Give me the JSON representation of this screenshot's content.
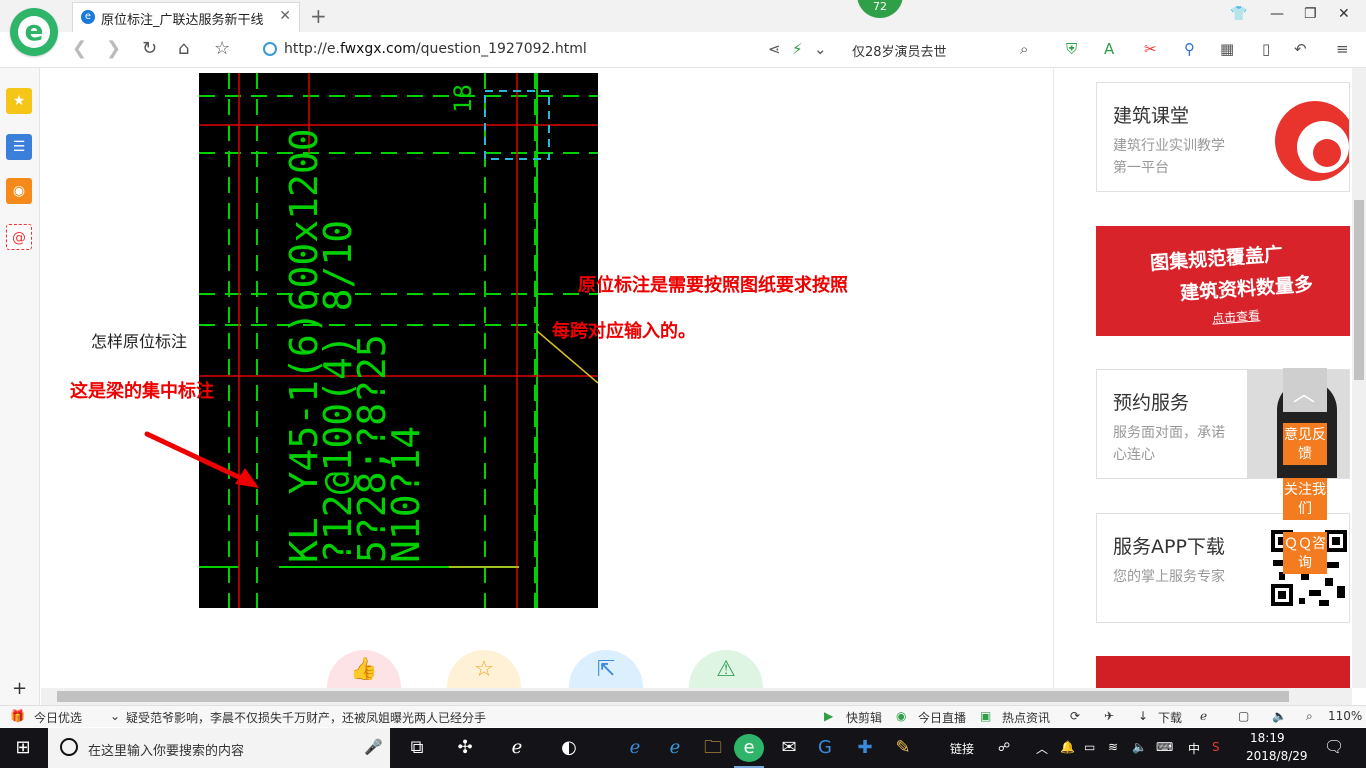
{
  "browser": {
    "tab_title": "原位标注_广联达服务新干线",
    "tab_close": "✕",
    "new_tab": "+",
    "badge": "72",
    "url_prefix": "http://e.",
    "url_domain": "fwxgx.com",
    "url_path": "/question_1927092.html",
    "search_suggestion": "仅28岁演员去世"
  },
  "page": {
    "annotation_1": "原位标注是需要按照图纸要求按照",
    "annotation_2": "每跨对应输入的。",
    "question": "怎样原位标注",
    "beam_note": "这是梁的集中标注",
    "cad_text": {
      "line1": "KL Y45-1(6)600x1200",
      "line2": "?12@100(4)  8/10",
      "line3": "5?28;?8?25",
      "line4": "N10?14",
      "corner": "18"
    }
  },
  "sidebar_cards": [
    {
      "title": "建筑课堂",
      "desc": "建筑行业实训教学第一平台"
    },
    {
      "title": "预约服务",
      "desc": "服务面对面，承诺心连心"
    },
    {
      "title": "服务APP下载",
      "desc": "您的掌上服务专家"
    }
  ],
  "banner": {
    "line1": "图集规范覆盖广",
    "line2": "建筑资料数量多",
    "cta": "点击查看"
  },
  "float_buttons": {
    "feedback": "意见反馈",
    "follow": "关注我们",
    "qq": "ＱＱ咨询"
  },
  "statusbar": {
    "today_pick": "今日优选",
    "news": "疑受范爷影响，李晨不仅损失千万财产，还被凤姐曝光两人已经分手",
    "quick_clip": "快剪辑",
    "live": "今日直播",
    "hot_news": "热点资讯",
    "download": "下载",
    "zoom": "110%"
  },
  "taskbar": {
    "search_placeholder": "在这里输入你要搜索的内容",
    "link": "链接",
    "ime": "中",
    "time": "18:19",
    "date": "2018/8/29"
  },
  "colors": {
    "brand_green": "#2fb56a",
    "annotation_red": "#e00000",
    "float_orange": "#f27c1f",
    "cad_green": "#00d000",
    "cad_red": "#e00000"
  }
}
